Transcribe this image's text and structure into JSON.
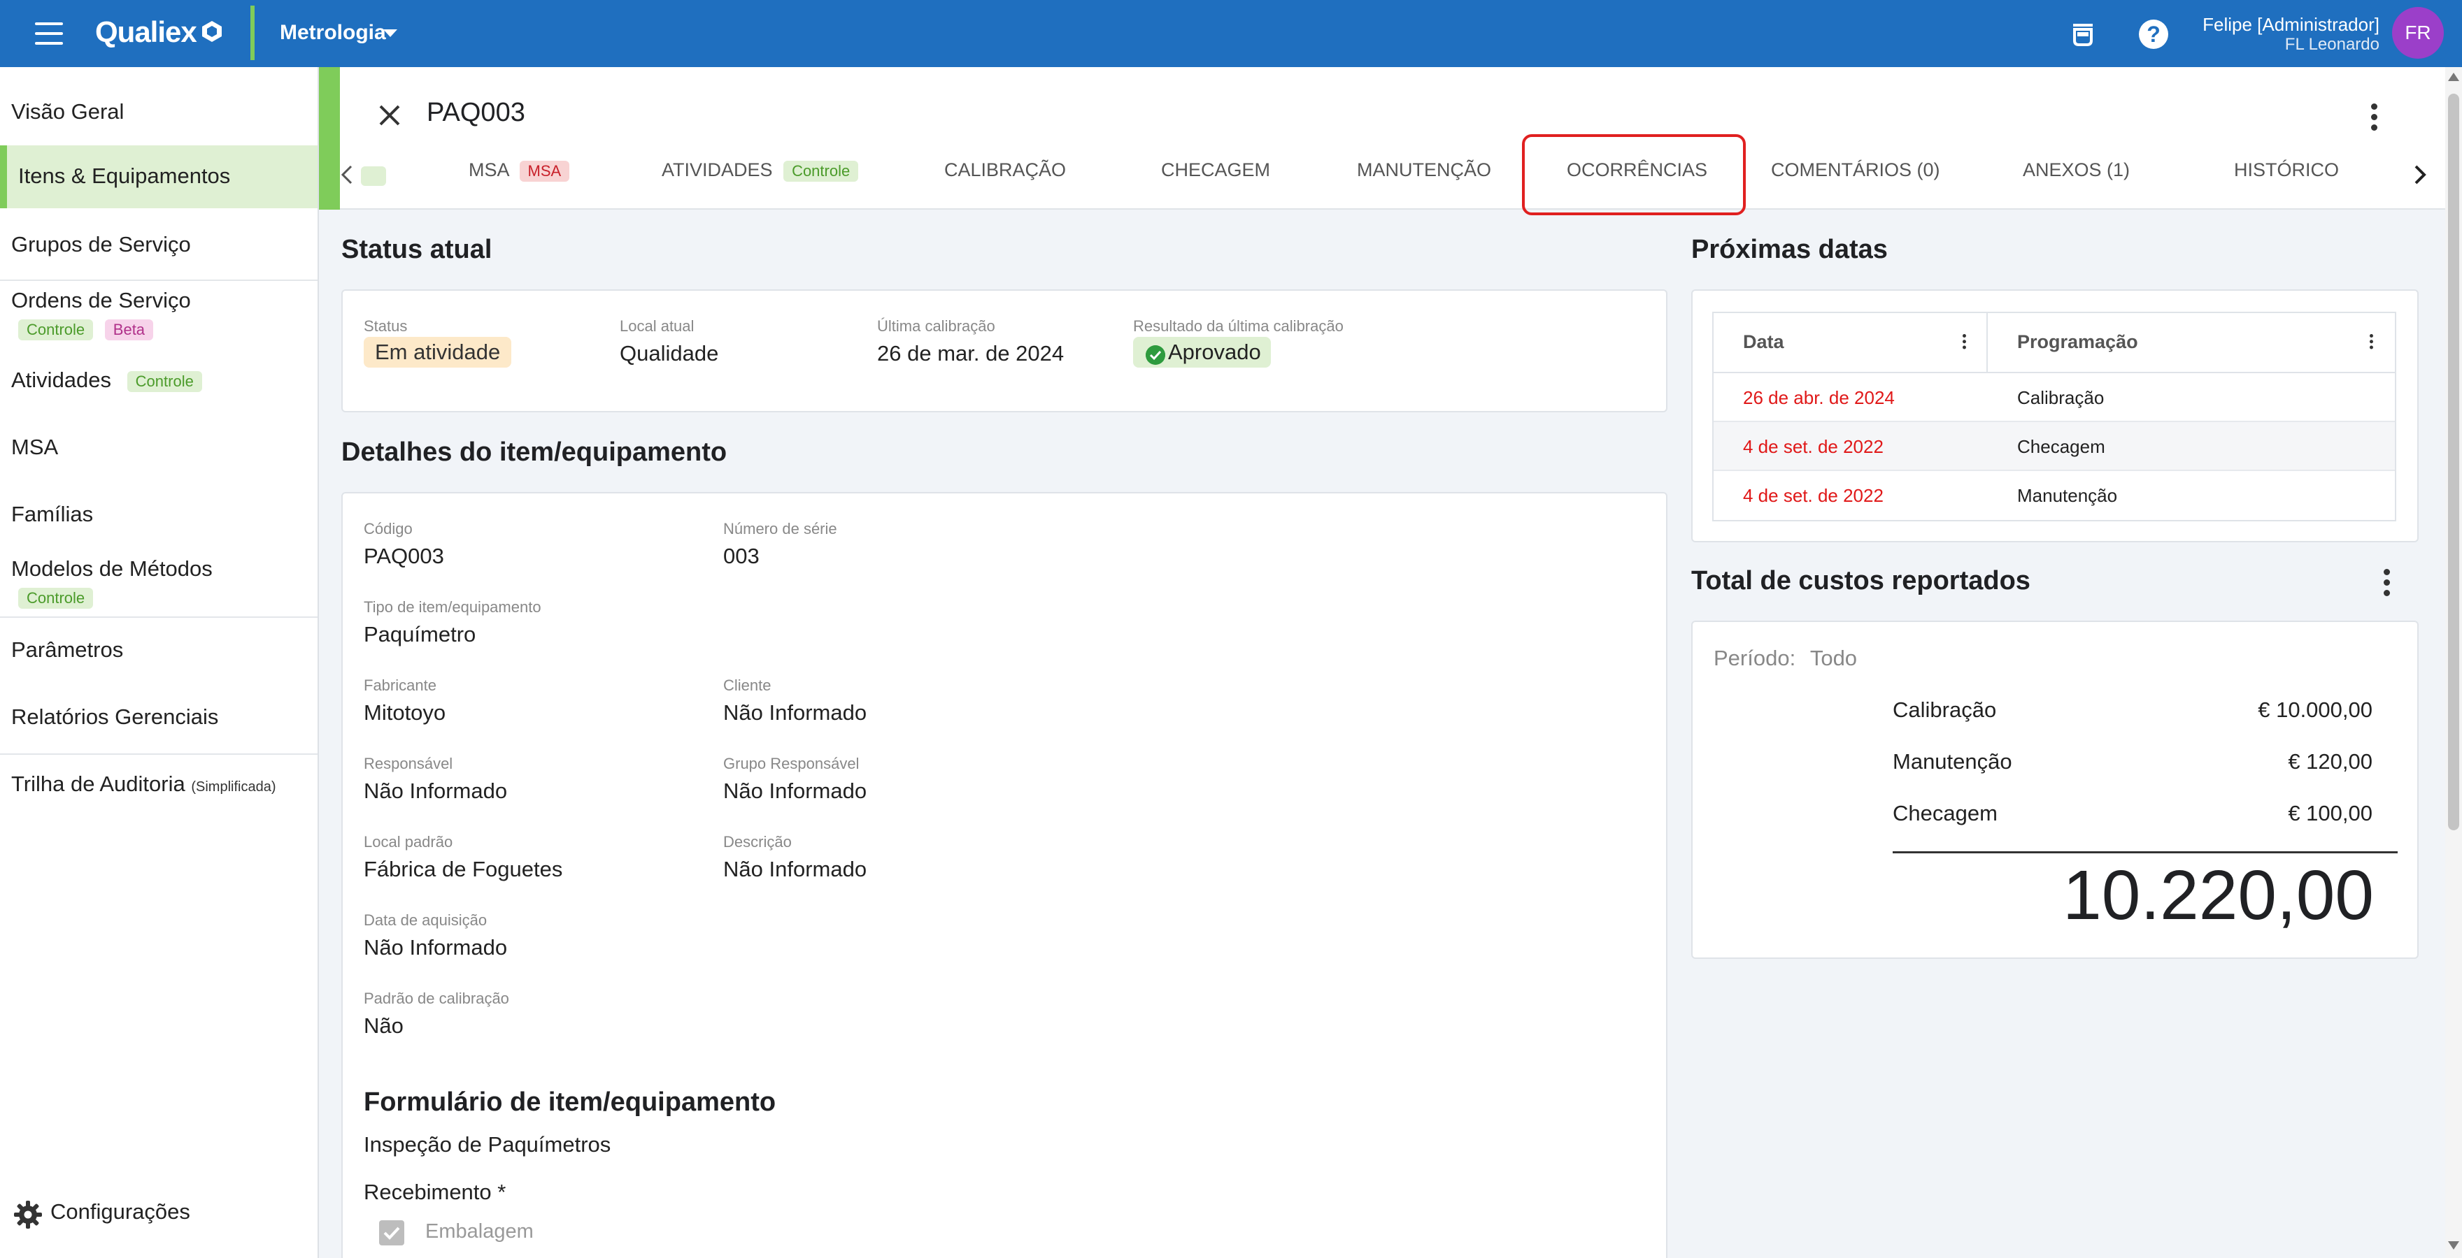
{
  "topbar": {
    "logo": "Qualiex",
    "module": "Metrologia",
    "user_name": "Felipe [Administrador]",
    "user_sub": "FL Leonardo",
    "avatar_initials": "FR",
    "icons": [
      "menu-icon",
      "coffee-cup-icon",
      "help-icon"
    ]
  },
  "sidebar": {
    "items": [
      {
        "label": "Visão Geral"
      },
      {
        "label": "Itens & Equipamentos",
        "active": true
      },
      {
        "label": "Grupos de Serviço"
      },
      {
        "label": "Ordens de Serviço",
        "chips": [
          "Controle",
          "Beta"
        ]
      },
      {
        "label": "Atividades",
        "chips": [
          "Controle"
        ]
      },
      {
        "label": "MSA"
      },
      {
        "label": "Famílias"
      },
      {
        "label": "Modelos de Métodos",
        "chips": [
          "Controle"
        ]
      },
      {
        "label": "Parâmetros"
      },
      {
        "label": "Relatórios Gerenciais"
      },
      {
        "label": "Trilha de Auditoria",
        "note": "(Simplificada)"
      }
    ],
    "config_label": "Configurações"
  },
  "header": {
    "title": "PAQ003",
    "tabs": [
      {
        "label": "MSA",
        "chip": "MSA"
      },
      {
        "label": "ATIVIDADES",
        "chip": "Controle"
      },
      {
        "label": "CALIBRAÇÃO"
      },
      {
        "label": "CHECAGEM"
      },
      {
        "label": "MANUTENÇÃO"
      },
      {
        "label": "OCORRÊNCIAS",
        "highlighted": true
      },
      {
        "label": "COMENTÁRIOS (0)"
      },
      {
        "label": "ANEXOS (1)"
      },
      {
        "label": "HISTÓRICO"
      }
    ]
  },
  "status": {
    "section_title": "Status atual",
    "status_label": "Status",
    "status_value": "Em atividade",
    "local_label": "Local atual",
    "local_value": "Qualidade",
    "last_cal_label": "Última calibração",
    "last_cal_value": "26 de mar. de 2024",
    "result_label": "Resultado da última calibração",
    "result_value": "Aprovado"
  },
  "details": {
    "section_title": "Detalhes do item/equipamento",
    "fields": {
      "codigo": {
        "label": "Código",
        "value": "PAQ003"
      },
      "serie": {
        "label": "Número de série",
        "value": "003"
      },
      "tipo": {
        "label": "Tipo de item/equipamento",
        "value": "Paquímetro"
      },
      "fabricante": {
        "label": "Fabricante",
        "value": "Mitotoyo"
      },
      "cliente": {
        "label": "Cliente",
        "value": "Não Informado"
      },
      "responsavel": {
        "label": "Responsável",
        "value": "Não Informado"
      },
      "grupo": {
        "label": "Grupo Responsável",
        "value": "Não Informado"
      },
      "local_padrao": {
        "label": "Local padrão",
        "value": "Fábrica de Foguetes"
      },
      "descricao": {
        "label": "Descrição",
        "value": "Não Informado"
      },
      "aquisicao": {
        "label": "Data de aquisição",
        "value": "Não Informado"
      },
      "padrao_cal": {
        "label": "Padrão de calibração",
        "value": "Não"
      }
    }
  },
  "form": {
    "section_title": "Formulário de item/equipamento",
    "name": "Inspeção de Paquímetros",
    "group": "Recebimento *",
    "checkbox_label": "Embalagem"
  },
  "next_dates": {
    "section_title": "Próximas datas",
    "columns": [
      "Data",
      "Programação"
    ],
    "rows": [
      {
        "date": "26 de abr. de 2024",
        "program": "Calibração"
      },
      {
        "date": "4 de set. de 2022",
        "program": "Checagem"
      },
      {
        "date": "4 de set. de 2022",
        "program": "Manutenção"
      }
    ]
  },
  "costs": {
    "section_title": "Total de custos reportados",
    "period_label": "Período:",
    "period_value": "Todo",
    "items": [
      {
        "name": "Calibração",
        "value": "€ 10.000,00"
      },
      {
        "name": "Manutenção",
        "value": "€ 120,00"
      },
      {
        "name": "Checagem",
        "value": "€ 100,00"
      }
    ],
    "total": "10.220,00"
  }
}
